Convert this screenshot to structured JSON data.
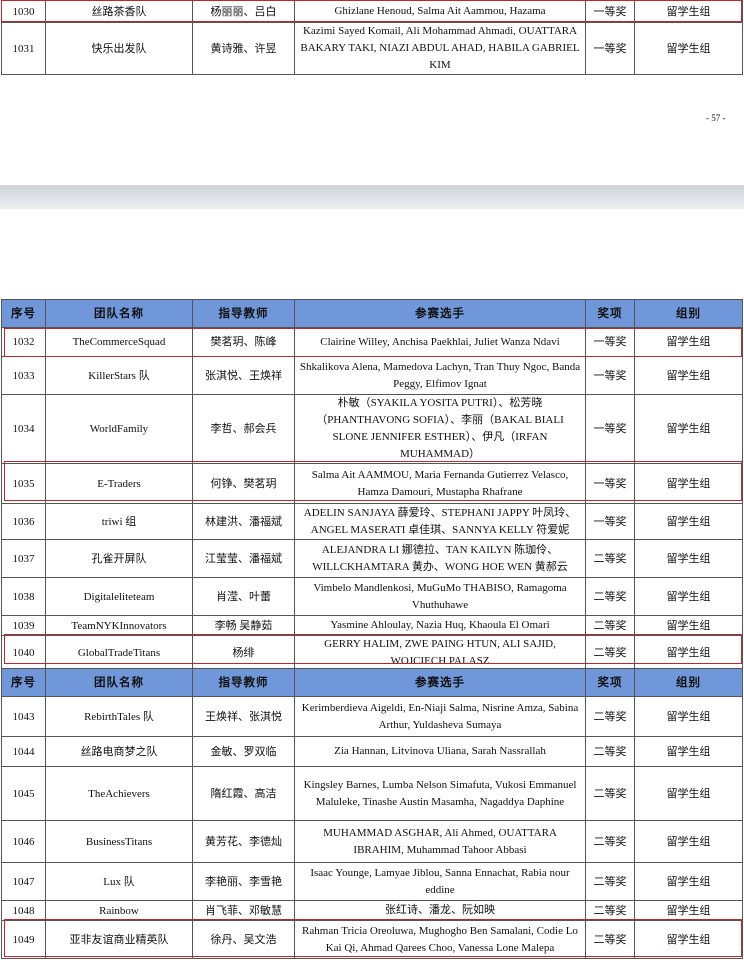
{
  "page_number": "- 57 -",
  "headers": {
    "no": "序号",
    "team": "团队名称",
    "advisor": "指导教师",
    "members": "参赛选手",
    "award": "奖项",
    "group": "组别"
  },
  "table_top": {
    "rows": [
      {
        "no": "1030",
        "team": "丝路茶香队",
        "advisor": "杨丽丽、吕白",
        "members": "Ghizlane Henoud, Salma Ait Aammou, Hazama",
        "award": "一等奖",
        "group": "留学生组"
      },
      {
        "no": "1031",
        "team": "快乐出发队",
        "advisor": "黄诗雅、许昱",
        "members": "Kazimi Sayed Komail, Ali Mohammad Ahmadi, OUATTARA BAKARY TAKI, NIAZI ABDUL AHAD, HABILA GABRIEL KIM",
        "award": "一等奖",
        "group": "留学生组"
      }
    ]
  },
  "table_mid": {
    "rows": [
      {
        "no": "1032",
        "team": "TheCommerceSquad",
        "advisor": "樊茗玥、陈峰",
        "members": "Clairine Willey, Anchisa Paekhlai, Juliet Wanza Ndavi",
        "award": "一等奖",
        "group": "留学生组"
      },
      {
        "no": "1033",
        "team": "KillerStars 队",
        "advisor": "张淇悦、王焕祥",
        "members": "Shkalikova Alena, Mamedova Lachyn, Tran Thuy Ngoc, Banda Peggy, Elfimov Ignat",
        "award": "一等奖",
        "group": "留学生组"
      },
      {
        "no": "1034",
        "team": "WorldFamily",
        "advisor": "李哲、郝会兵",
        "members": "朴敏（SYAKILA YOSITA PUTRI）、松芳晓（PHANTHAVONG SOFIA）、李丽（BAKAL BIALI SLONE JENNIFER ESTHER）、伊凡（IRFAN MUHAMMAD）",
        "award": "一等奖",
        "group": "留学生组"
      },
      {
        "no": "1035",
        "team": "E-Traders",
        "advisor": "何铮、樊茗玥",
        "members": "Salma Ait AAMMOU, Maria Fernanda Gutierrez Velasco, Hamza Damouri, Mustapha Rhafrane",
        "award": "一等奖",
        "group": "留学生组"
      },
      {
        "no": "1036",
        "team": "triwi 组",
        "advisor": "林建洪、潘福斌",
        "members": "ADELIN SANJAYA 薛爱玲、STEPHANI JAPPY 叶凤玲、ANGEL MASERATI 卓佳琪、SANNYA KELLY 符爱妮",
        "award": "一等奖",
        "group": "留学生组"
      },
      {
        "no": "1037",
        "team": "孔雀开屏队",
        "advisor": "江莹莹、潘福斌",
        "members": "ALEJANDRA LI 娜德拉、TAN KAILYN 陈珈伶、WILLCKHAMTARA 黄办、WONG HOE WEN 黄郝云",
        "award": "二等奖",
        "group": "留学生组"
      },
      {
        "no": "1038",
        "team": "Digitaleliteteam",
        "advisor": "肖滢、叶蕾",
        "members": "Vimbelo Mandlenkosi, MuGuMo THABISO, Ramagoma Vhuthuhawe",
        "award": "二等奖",
        "group": "留学生组"
      },
      {
        "no": "1039",
        "team": "TeamNYKInnovators",
        "advisor": "李畅 吴静茹",
        "members": "Yasmine Ahloulay, Nazia Huq, Khaoula El Omari",
        "award": "二等奖",
        "group": "留学生组"
      },
      {
        "no": "1040",
        "team": "GlobalTradeTitans",
        "advisor": "杨绯",
        "members": "GERRY HALIM, ZWE PAING HTUN, ALI SAJID, WOJCIECH PALASZ",
        "award": "二等奖",
        "group": "留学生组"
      }
    ]
  },
  "table_bottom": {
    "rows": [
      {
        "no": "1043",
        "team": "RebirthTales 队",
        "advisor": "王焕祥、张淇悦",
        "members": "Kerimberdieva Aigeldi, En-Niaji Salma, Nisrine Amza, Sabina Arthur, Yuldasheva Sumaya",
        "award": "二等奖",
        "group": "留学生组"
      },
      {
        "no": "1044",
        "team": "丝路电商梦之队",
        "advisor": "金敏、罗双临",
        "members": "Zia Hannan, Litvinova Uliana, Sarah Nassrallah",
        "award": "二等奖",
        "group": "留学生组"
      },
      {
        "no": "1045",
        "team": "TheAchievers",
        "advisor": "隋红霞、高洁",
        "members": "Kingsley Barnes, Lumba Nelson Simafuta, Vukosi Emmanuel Maluleke, Tinashe Austin Masamha, Nagaddya Daphine",
        "award": "二等奖",
        "group": "留学生组"
      },
      {
        "no": "1046",
        "team": "BusinessTitans",
        "advisor": "黄芳花、李德灿",
        "members": "MUHAMMAD ASGHAR, Ali Ahmed, OUATTARA IBRAHIM, Muhammad Tahoor Abbasi",
        "award": "二等奖",
        "group": "留学生组"
      },
      {
        "no": "1047",
        "team": "Lux 队",
        "advisor": "李艳丽、李雪艳",
        "members": "Isaac Younge, Lamyae Jiblou, Sanna Ennachat, Rabia nour eddine",
        "award": "二等奖",
        "group": "留学生组"
      },
      {
        "no": "1048",
        "team": "Rainbow",
        "advisor": "肖飞菲、邓敏慧",
        "members": "张红诗、潘龙、阮如映",
        "award": "二等奖",
        "group": "留学生组"
      },
      {
        "no": "1049",
        "team": "亚非友谊商业精英队",
        "advisor": "徐丹、吴文浩",
        "members": "Rahman Tricia Oreoluwa, Mughogho Ben Samalani, Codie Lo Kai Qi, Ahmad Qarees Choo, Vanessa Lone Malepa",
        "award": "二等奖",
        "group": "留学生组"
      }
    ]
  }
}
